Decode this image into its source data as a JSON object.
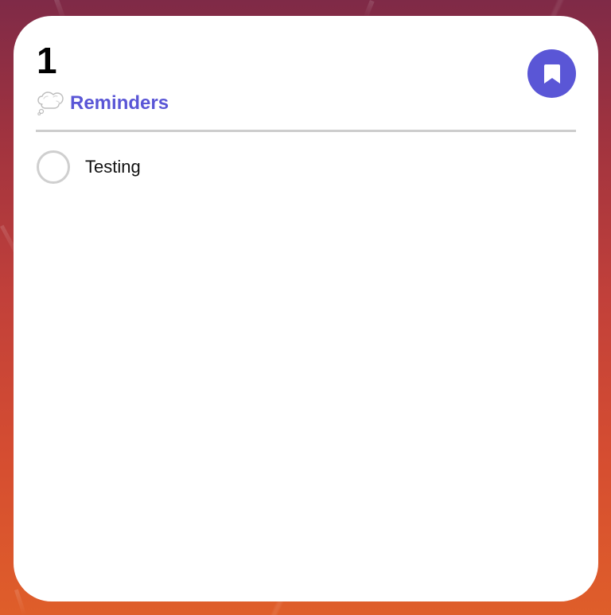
{
  "theme": {
    "accent_color": "#5a56d6",
    "background_gradient": [
      "#7f2a47",
      "#df5e2a"
    ]
  },
  "widget": {
    "count": "1",
    "list": {
      "icon": "thought-balloon-icon",
      "title": "Reminders"
    },
    "header_button": {
      "icon": "bookmark-icon"
    },
    "items": [
      {
        "text": "Testing",
        "completed": false
      }
    ]
  }
}
